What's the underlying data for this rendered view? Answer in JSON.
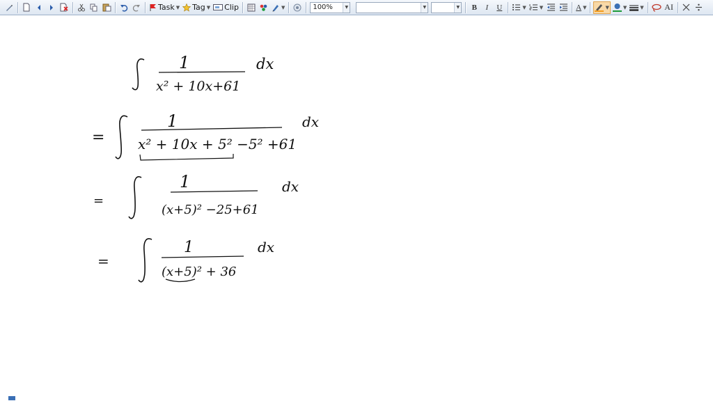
{
  "toolbar": {
    "task_label": "Task",
    "tag_label": "Tag",
    "clip_label": "Clip",
    "zoom_value": "100%",
    "font_name_value": "",
    "font_size_value": "",
    "bold_label": "B",
    "italic_label": "I",
    "underline_label": "U",
    "text_style_label": "A",
    "font_size_aa_label": "AI",
    "icons": [
      "pen-icon",
      "new-page-icon",
      "prev-page-icon",
      "next-page-icon",
      "delete-page-icon",
      "cut-icon",
      "copy-icon",
      "paste-icon",
      "undo-icon",
      "redo-icon",
      "flag-icon",
      "star-icon",
      "clip-icon",
      "grid-icon",
      "color-palette-icon",
      "pen-tool-icon",
      "camera-icon",
      "bullet-list-icon",
      "numbered-list-icon",
      "outdent-icon",
      "indent-icon",
      "font-color-icon",
      "highlighter-icon",
      "fill-color-icon",
      "line-style-icon",
      "lasso-icon",
      "close-icon",
      "divide-icon"
    ],
    "colors": {
      "highlight": "#f29b1d",
      "fill": "#1b9b3a",
      "accent": "#2a5caa"
    }
  },
  "handwriting": {
    "line1": {
      "numerator": "1",
      "denominator": "x² + 10x+61",
      "suffix": "dx"
    },
    "line2": {
      "prefix": "=",
      "numerator": "1",
      "denominator": "x² + 10x + 5² −5² +61",
      "suffix": "dx"
    },
    "line3": {
      "prefix": "=",
      "numerator": "1",
      "denominator": "(x+5)² −25+61",
      "suffix": "dx"
    },
    "line4": {
      "prefix": "=",
      "numerator": "1",
      "denominator": "(x+5)² + 36",
      "suffix": "dx"
    }
  }
}
